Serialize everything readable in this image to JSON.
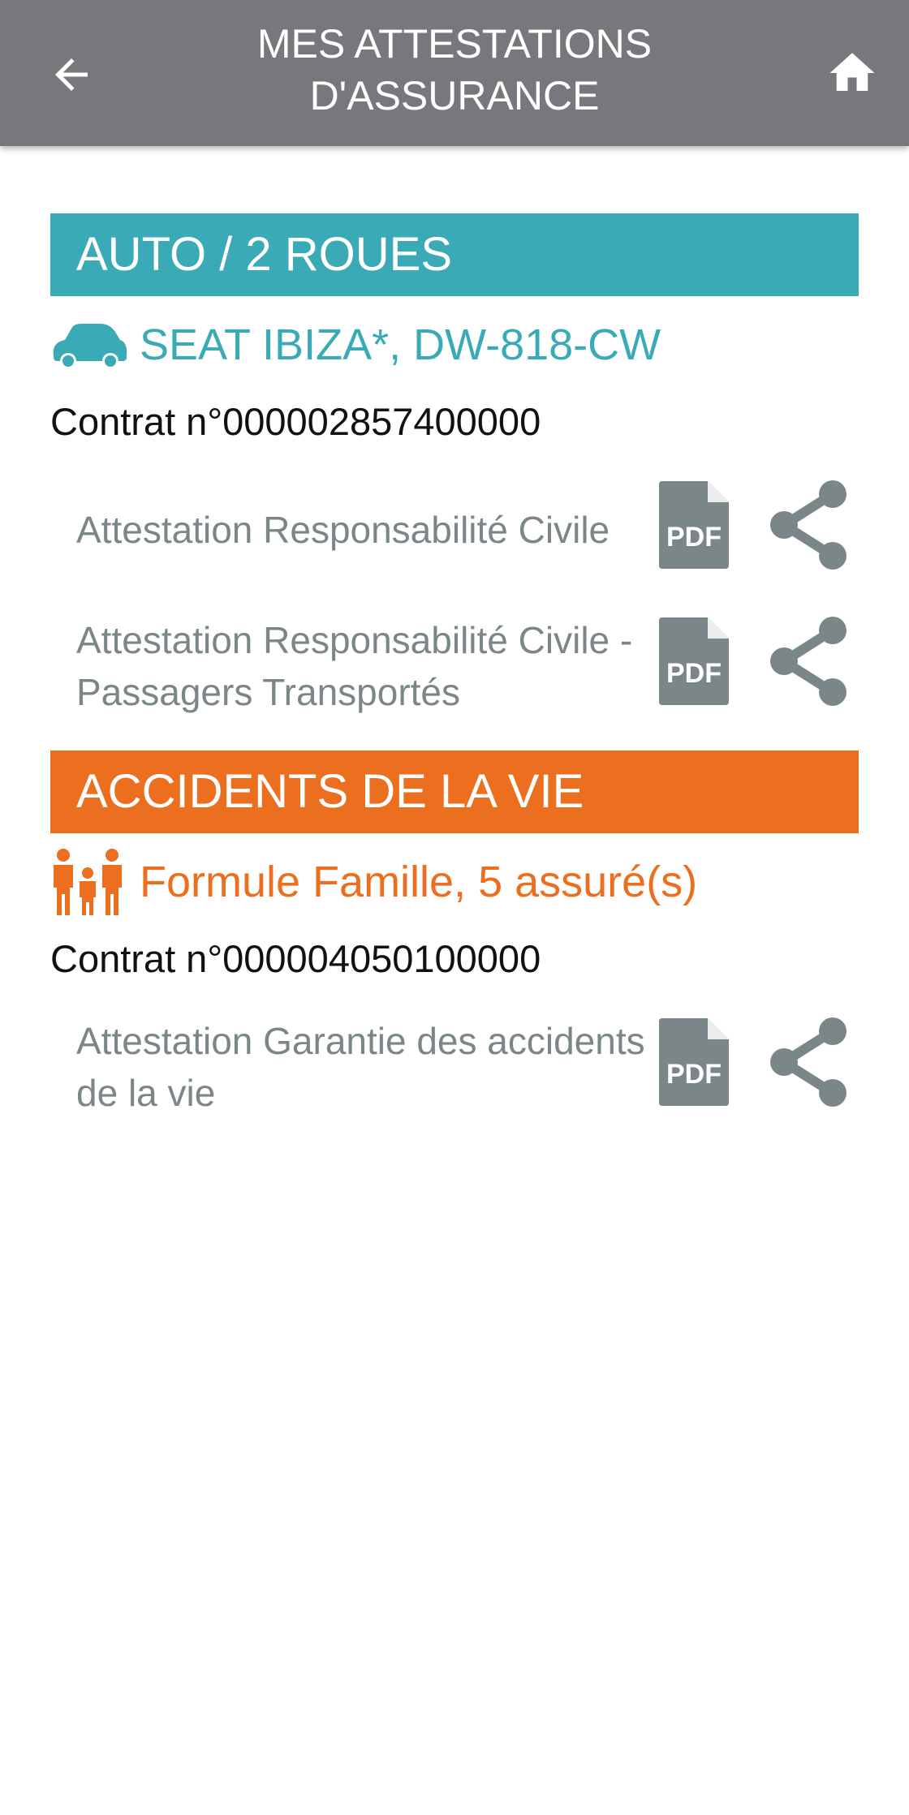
{
  "header": {
    "title": "MES ATTESTATIONS\nD'ASSURANCE",
    "back_icon": "arrow-left-icon",
    "home_icon": "home-icon",
    "background": "#77787b"
  },
  "sections": [
    {
      "name": "AUTO / 2 ROUES",
      "color": "#3aabb6",
      "item": {
        "icon": "car-icon",
        "title": "SEAT IBIZA*, DW-818-CW",
        "contract": "Contrat n°000002857400000",
        "documents": [
          {
            "label": "Attestation Responsabilité Civile"
          },
          {
            "label": "Attestation Responsabilité Civile -  Passagers Transportés"
          }
        ]
      }
    },
    {
      "name": "ACCIDENTS DE LA VIE",
      "color": "#ec6e1f",
      "item": {
        "icon": "family-icon",
        "title": "Formule Famille, 5 assuré(s)",
        "contract": "Contrat n°000004050100000",
        "documents": [
          {
            "label": "Attestation Garantie des accidents de la vie"
          }
        ]
      }
    }
  ],
  "pdf_icon_text": "PDF",
  "icon_gray": "#7b8688"
}
